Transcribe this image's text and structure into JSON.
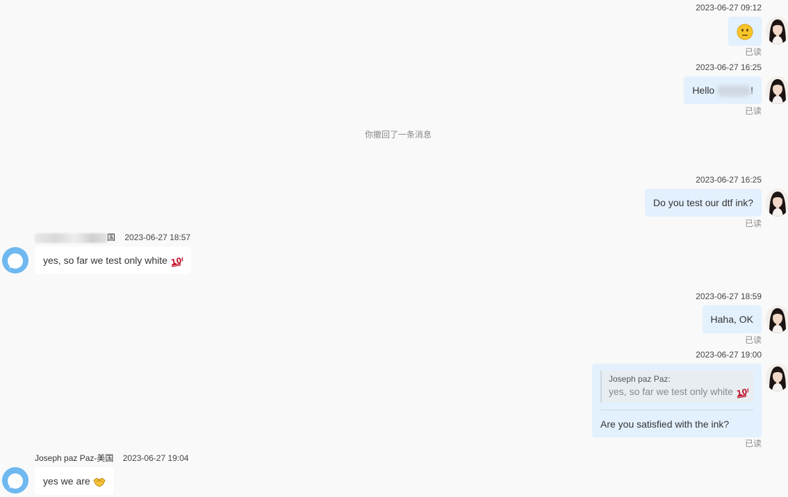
{
  "messages": {
    "m1": {
      "time": "2023-06-27 09:12",
      "status": "已读",
      "emoji": "neutral-face-emoji"
    },
    "m2": {
      "time": "2023-06-27 16:25",
      "text_prefix": "Hello",
      "text_suffix": "!",
      "status": "已读"
    },
    "recall_notice": "你撤回了一条消息",
    "m3": {
      "time": "2023-06-27 16:25",
      "text": "Do you test our dtf ink?",
      "status": "已读"
    },
    "m4": {
      "sender_suffix": "国",
      "time": "2023-06-27 18:57",
      "text": "yes, so far we test only white",
      "emoji": "hundred-points-emoji"
    },
    "m5": {
      "time": "2023-06-27 18:59",
      "text": "Haha, OK",
      "status": "已读"
    },
    "m6": {
      "time": "2023-06-27 19:00",
      "quote_name": "Joseph paz Paz:",
      "quote_text": "yes, so far we test only white",
      "text": "Are you satisfied with the ink?",
      "status": "已读"
    },
    "m7": {
      "sender": "Joseph paz Paz-美国",
      "time": "2023-06-27 19:04",
      "text": "yes we are",
      "emoji": "handshake-emoji"
    }
  },
  "colors": {
    "background": "#f9f9f9",
    "outgoing_bubble": "#e3f0fd",
    "incoming_bubble": "#ffffff",
    "contact_avatar": "#6fb8f0"
  }
}
